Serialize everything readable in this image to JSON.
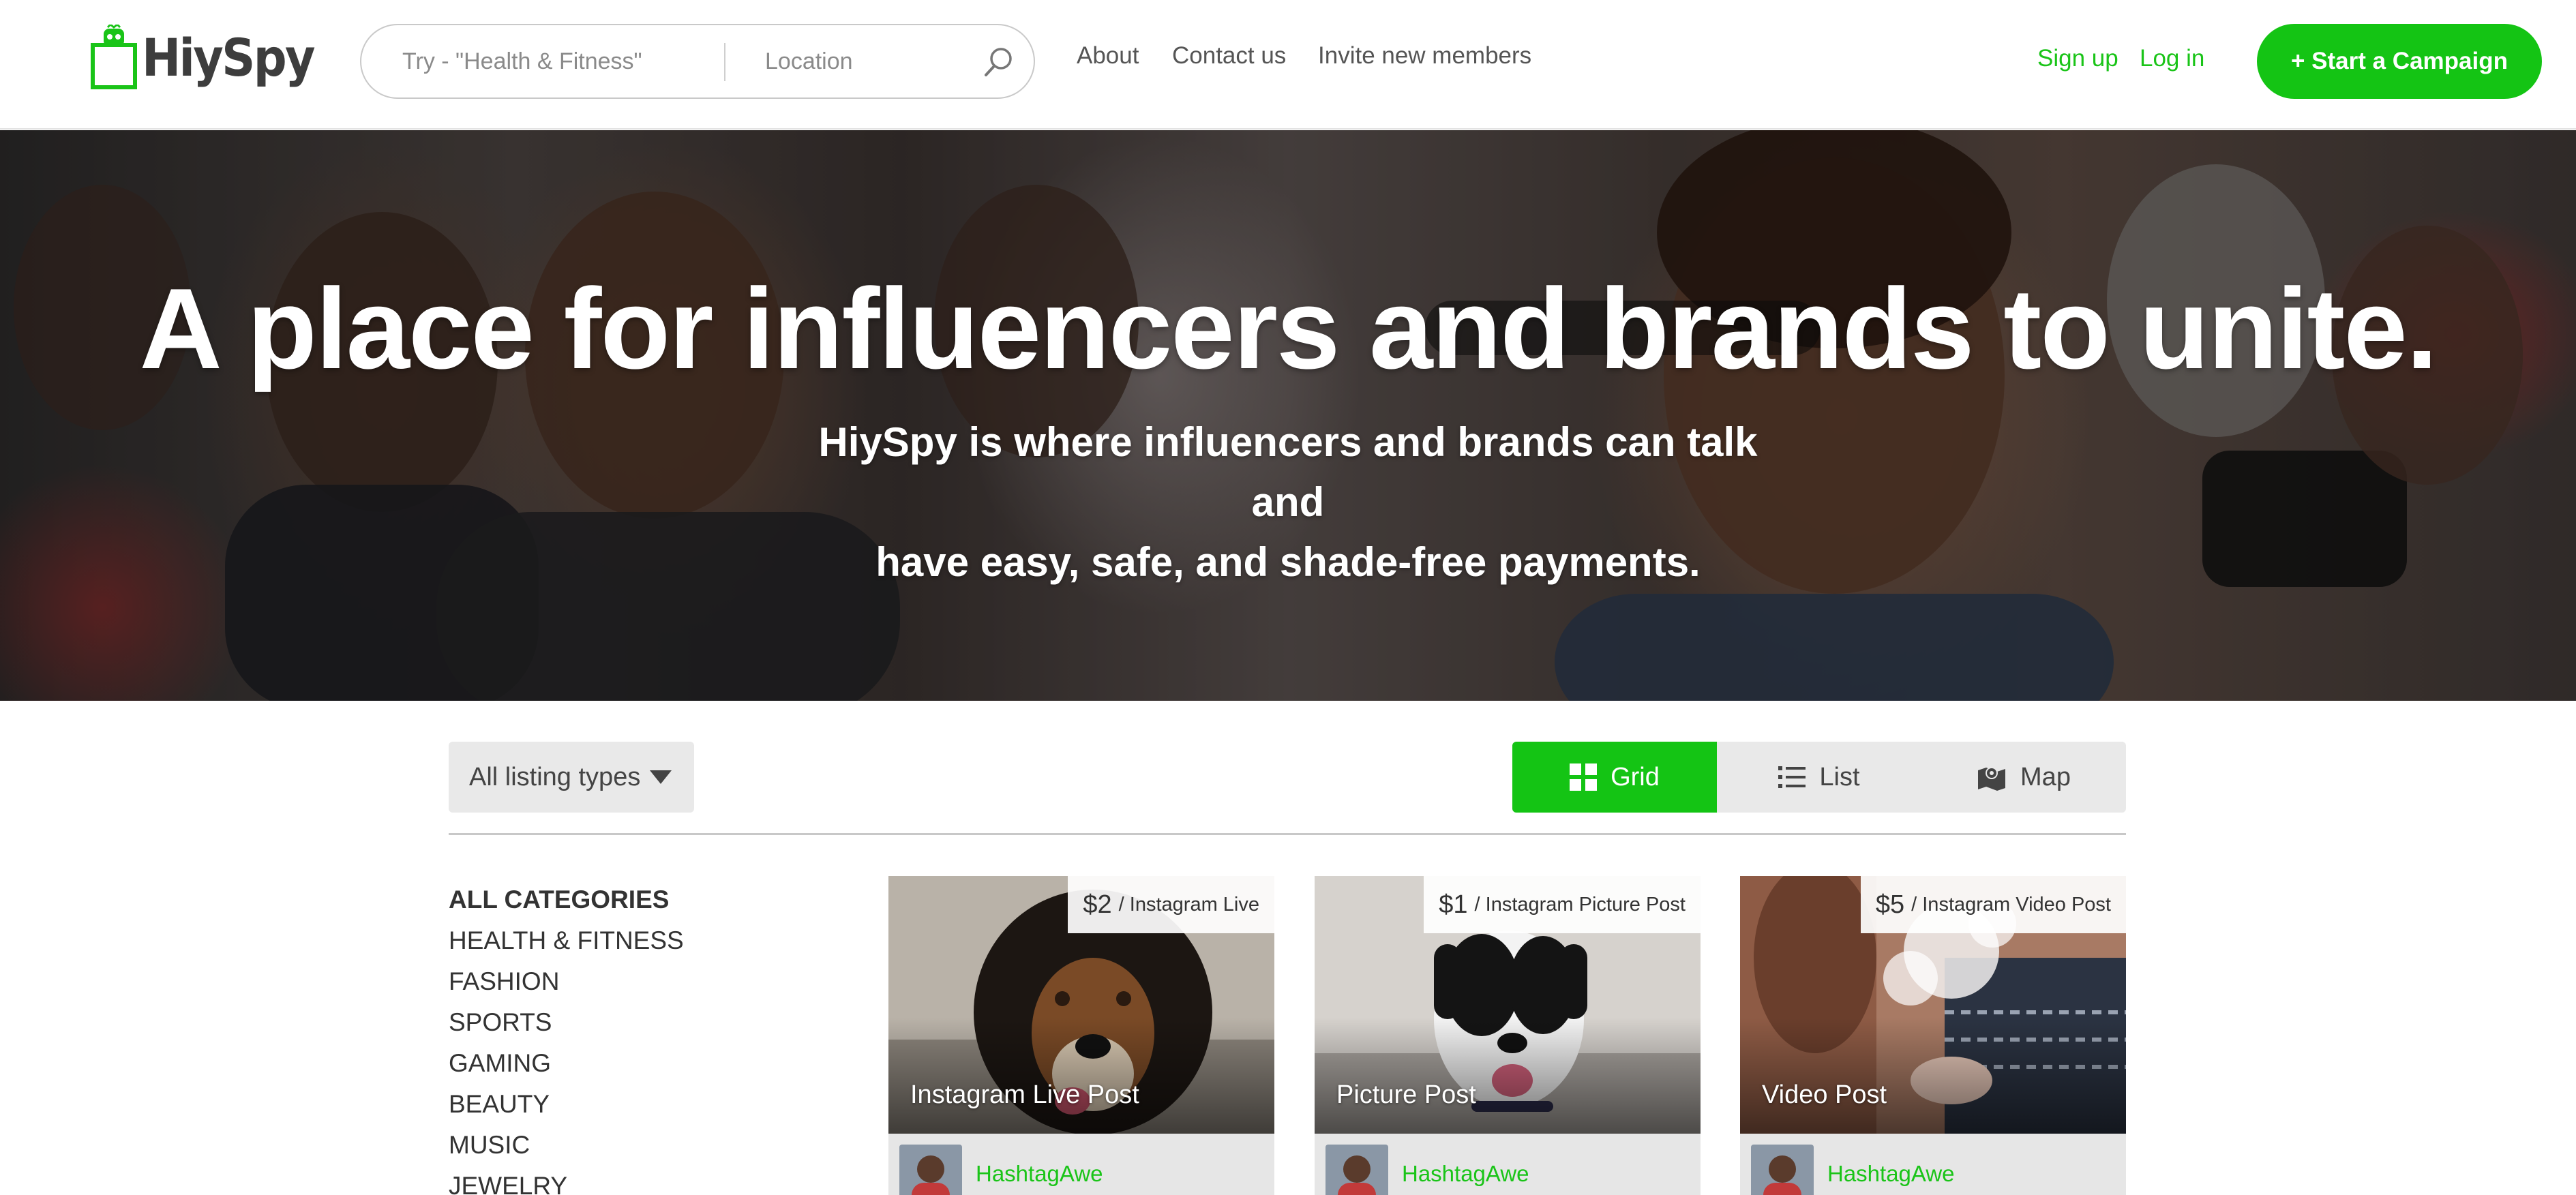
{
  "header": {
    "logo_text": "HiySpy",
    "search": {
      "keyword_placeholder": "Try - \"Health & Fitness\"",
      "location_placeholder": "Location"
    },
    "nav": [
      "About",
      "Contact us",
      "Invite new members"
    ],
    "signup": "Sign up",
    "login": "Log in",
    "cta": "+ Start a Campaign"
  },
  "hero": {
    "title": "A place for influencers and brands to unite.",
    "subtitle_line1": "HiySpy is where influencers and brands can talk and",
    "subtitle_line2": "have easy, safe, and shade-free payments."
  },
  "filters": {
    "listing_types": "All listing types",
    "views": [
      "Grid",
      "List",
      "Map"
    ],
    "active_view": "Grid"
  },
  "categories": [
    "ALL CATEGORIES",
    "HEALTH & FITNESS",
    "FASHION",
    "SPORTS",
    "GAMING",
    "BEAUTY",
    "MUSIC",
    "JEWELRY"
  ],
  "listings": [
    {
      "price": "$2",
      "unit": "/ Instagram Live",
      "title": "Instagram Live Post",
      "author": "HashtagAwe"
    },
    {
      "price": "$1",
      "unit": "/ Instagram Picture Post",
      "title": "Picture Post",
      "author": "HashtagAwe"
    },
    {
      "price": "$5",
      "unit": "/ Instagram Video Post",
      "title": "Video Post",
      "author": "HashtagAwe"
    }
  ],
  "colors": {
    "brand_green": "#14c414",
    "link_green": "#1ac418"
  }
}
